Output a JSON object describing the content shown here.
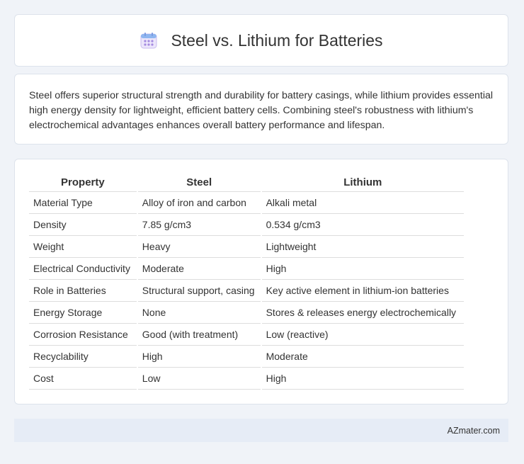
{
  "header": {
    "title": "Steel vs. Lithium for Batteries",
    "icon": "calendar-icon"
  },
  "description": "Steel offers superior structural strength and durability for battery casings, while lithium provides essential high energy density for lightweight, efficient battery cells. Combining steel's robustness with lithium's electrochemical advantages enhances overall battery performance and lifespan.",
  "table": {
    "headers": [
      "Property",
      "Steel",
      "Lithium"
    ],
    "rows": [
      [
        "Material Type",
        "Alloy of iron and carbon",
        "Alkali metal"
      ],
      [
        "Density",
        "7.85 g/cm3",
        "0.534 g/cm3"
      ],
      [
        "Weight",
        "Heavy",
        "Lightweight"
      ],
      [
        "Electrical Conductivity",
        "Moderate",
        "High"
      ],
      [
        "Role in Batteries",
        "Structural support, casing",
        "Key active element in lithium-ion batteries"
      ],
      [
        "Energy Storage",
        "None",
        "Stores & releases energy electrochemically"
      ],
      [
        "Corrosion Resistance",
        "Good (with treatment)",
        "Low (reactive)"
      ],
      [
        "Recyclability",
        "High",
        "Moderate"
      ],
      [
        "Cost",
        "Low",
        "High"
      ]
    ]
  },
  "footer": {
    "brand": "AZmater.com"
  },
  "colors": {
    "background": "#f0f3f8",
    "card": "#ffffff",
    "footer": "#e6ecf6",
    "icon_accent": "#a58be0"
  }
}
